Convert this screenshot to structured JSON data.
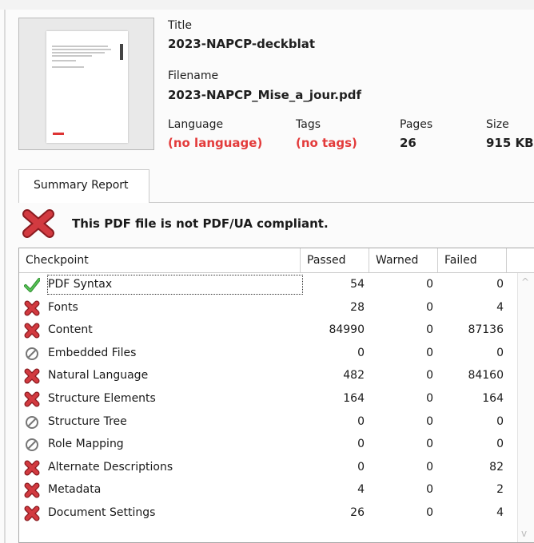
{
  "document": {
    "title_label": "Title",
    "title_value": "2023-NAPCP-deckblat",
    "filename_label": "Filename",
    "filename_value": "2023-NAPCP_Mise_a_jour.pdf",
    "language_label": "Language",
    "language_value": "(no language)",
    "tags_label": "Tags",
    "tags_value": "(no tags)",
    "pages_label": "Pages",
    "pages_value": "26",
    "size_label": "Size",
    "size_value": "915 KB"
  },
  "tab": {
    "label": "Summary Report"
  },
  "verdict": {
    "text": "This PDF file is not PDF/UA compliant."
  },
  "table": {
    "headers": {
      "checkpoint": "Checkpoint",
      "passed": "Passed",
      "warned": "Warned",
      "failed": "Failed"
    },
    "rows": [
      {
        "name": "PDF Syntax",
        "status": "pass-check-icon",
        "passed": "54",
        "warned": "0",
        "failed": "0"
      },
      {
        "name": "Fonts",
        "status": "fail-x-icon",
        "passed": "28",
        "warned": "0",
        "failed": "4"
      },
      {
        "name": "Content",
        "status": "fail-x-icon",
        "passed": "84990",
        "warned": "0",
        "failed": "87136"
      },
      {
        "name": "Embedded Files",
        "status": "not-applicable-icon",
        "passed": "0",
        "warned": "0",
        "failed": "0"
      },
      {
        "name": "Natural Language",
        "status": "fail-x-icon",
        "passed": "482",
        "warned": "0",
        "failed": "84160"
      },
      {
        "name": "Structure Elements",
        "status": "fail-x-icon",
        "passed": "164",
        "warned": "0",
        "failed": "164"
      },
      {
        "name": "Structure Tree",
        "status": "not-applicable-icon",
        "passed": "0",
        "warned": "0",
        "failed": "0"
      },
      {
        "name": "Role Mapping",
        "status": "not-applicable-icon",
        "passed": "0",
        "warned": "0",
        "failed": "0"
      },
      {
        "name": "Alternate Descriptions",
        "status": "fail-x-icon",
        "passed": "0",
        "warned": "0",
        "failed": "82"
      },
      {
        "name": "Metadata",
        "status": "fail-x-icon",
        "passed": "4",
        "warned": "0",
        "failed": "2"
      },
      {
        "name": "Document Settings",
        "status": "fail-x-icon",
        "passed": "26",
        "warned": "0",
        "failed": "4"
      }
    ]
  },
  "colors": {
    "error_text": "#e33b3b",
    "fail_icon": "#c0262d",
    "pass_icon": "#3aa23a"
  }
}
